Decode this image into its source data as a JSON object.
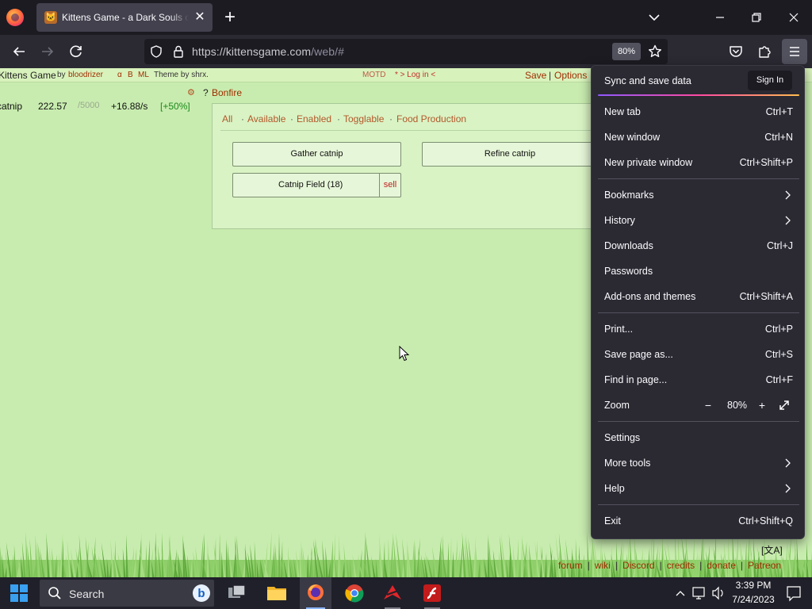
{
  "browser": {
    "tab_title": "Kittens Game - a Dark Souls of Incremental",
    "url_host": "https://kittensgame.com",
    "url_path": "/web/#",
    "zoom_badge": "80%"
  },
  "game": {
    "title": "Kittens Game",
    "by": "by",
    "author": "bloodrizer",
    "links": [
      "α",
      "B",
      "ML"
    ],
    "theme": "Theme by shrx.",
    "motd": "MOTD",
    "login": "* > Log in <",
    "save": "Save",
    "options": "Options"
  },
  "resource": {
    "name": "catnip",
    "amount": "222.57",
    "max": "/5000",
    "rate": "+16.88/s",
    "bonus": "[+50%]"
  },
  "bonfire": {
    "gear": "⚙",
    "help": "?",
    "title": "Bonfire",
    "filters": [
      "All",
      "Available",
      "Enabled",
      "Togglable",
      "Food Production"
    ],
    "gather": "Gather catnip",
    "refine": "Refine catnip",
    "field": "Catnip Field (18)",
    "sell": "sell"
  },
  "footer": {
    "lang": "[文A]",
    "links": [
      "forum",
      "wiki",
      "Discord",
      "credits",
      "donate",
      "Patreon"
    ]
  },
  "menu": {
    "sync_title": "Sync and save data",
    "sign_in": "Sign In",
    "items": [
      {
        "label": "New tab",
        "shortcut": "Ctrl+T"
      },
      {
        "label": "New window",
        "shortcut": "Ctrl+N"
      },
      {
        "label": "New private window",
        "shortcut": "Ctrl+Shift+P"
      },
      {
        "label": "Bookmarks",
        "shortcut": ""
      },
      {
        "label": "History",
        "shortcut": ""
      },
      {
        "label": "Downloads",
        "shortcut": "Ctrl+J"
      },
      {
        "label": "Passwords",
        "shortcut": ""
      },
      {
        "label": "Add-ons and themes",
        "shortcut": "Ctrl+Shift+A"
      },
      {
        "label": "Print...",
        "shortcut": "Ctrl+P"
      },
      {
        "label": "Save page as...",
        "shortcut": "Ctrl+S"
      },
      {
        "label": "Find in page...",
        "shortcut": "Ctrl+F"
      },
      {
        "label": "Zoom",
        "shortcut": ""
      },
      {
        "label": "Settings",
        "shortcut": ""
      },
      {
        "label": "More tools",
        "shortcut": ""
      },
      {
        "label": "Help",
        "shortcut": ""
      },
      {
        "label": "Exit",
        "shortcut": "Ctrl+Shift+Q"
      }
    ],
    "zoom_minus": "−",
    "zoom_value": "80%",
    "zoom_plus": "+"
  },
  "taskbar": {
    "search": "Search",
    "time": "3:39 PM",
    "date": "7/24/2023"
  },
  "colors": {
    "page_bg": "#c8ecaf",
    "link": "#a02d00",
    "menu_bg": "#2b2a33",
    "chrome_bg": "#1c1b22"
  }
}
